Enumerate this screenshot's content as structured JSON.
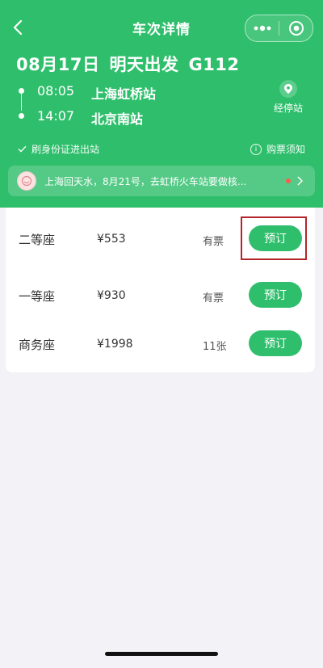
{
  "nav": {
    "title": "车次详情"
  },
  "trip": {
    "date": "08月17日",
    "depart_label": "明天出发",
    "train_no": "G112",
    "depart_time": "08:05",
    "depart_station": "上海虹桥站",
    "arrive_time": "14:07",
    "arrive_station": "北京南站",
    "via_label": "经停站"
  },
  "notes": {
    "id_check": "刷身份证进出站",
    "purchase_notice": "购票须知"
  },
  "notice": {
    "text": "上海回天水，8月21号，去虹桥火车站要做核..."
  },
  "seats": [
    {
      "name": "二等座",
      "price": "¥553",
      "availability": "有票",
      "button": "预订"
    },
    {
      "name": "一等座",
      "price": "¥930",
      "availability": "有票",
      "button": "预订"
    },
    {
      "name": "商务座",
      "price": "¥1998",
      "availability": "11张",
      "button": "预订"
    }
  ],
  "colors": {
    "brand": "#2fbf6c",
    "highlight": "#b3252a"
  },
  "icons": [
    "back-arrow-icon",
    "more-dots-icon",
    "mini-program-close-icon",
    "location-pin-icon",
    "checkmark-icon",
    "info-icon",
    "avatar-icon",
    "chevron-right-icon"
  ]
}
